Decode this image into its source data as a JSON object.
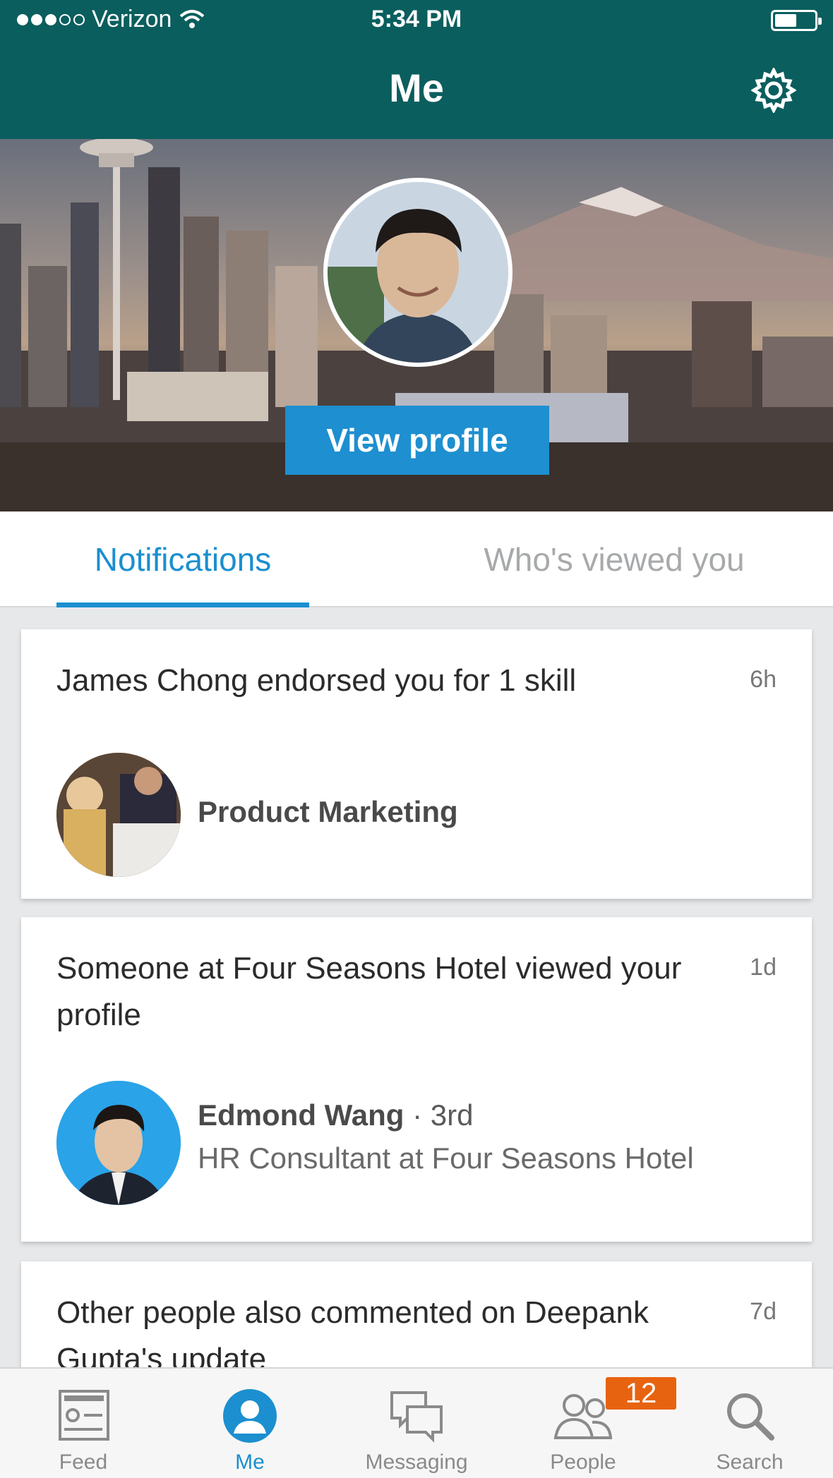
{
  "status_bar": {
    "carrier": "Verizon",
    "time": "5:34 PM"
  },
  "header": {
    "title": "Me"
  },
  "banner": {
    "view_profile_label": "View profile"
  },
  "tabs": [
    {
      "label": "Notifications",
      "active": true
    },
    {
      "label": "Who's viewed you",
      "active": false
    }
  ],
  "notifications": [
    {
      "title": "James Chong endorsed you for 1 skill",
      "time": "6h",
      "skill": "Product Marketing"
    },
    {
      "title": "Someone at Four Seasons Hotel viewed your profile",
      "time": "1d",
      "person_name": "Edmond Wang",
      "person_degree": " · 3rd",
      "person_title": "HR Consultant at Four Seasons Hotel"
    },
    {
      "title": "Other people also commented on Deepank Gupta's update",
      "time": "7d"
    }
  ],
  "bottom_nav": {
    "items": [
      {
        "label": "Feed",
        "icon": "feed-icon"
      },
      {
        "label": "Me",
        "icon": "me-icon",
        "active": true
      },
      {
        "label": "Messaging",
        "icon": "messaging-icon"
      },
      {
        "label": "People",
        "icon": "people-icon"
      },
      {
        "label": "Search",
        "icon": "search-icon"
      }
    ],
    "people_badge": "12"
  },
  "colors": {
    "header": "#0b5e5e",
    "accent": "#1b8fcf",
    "badge": "#e8630f"
  }
}
